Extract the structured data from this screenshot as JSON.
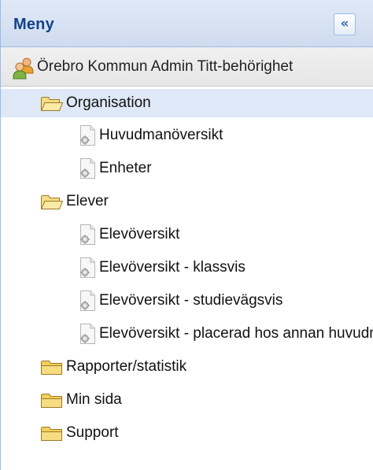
{
  "header": {
    "title": "Meny",
    "collapse_icon": "double-chevron-left-icon"
  },
  "user": {
    "icon": "users-icon",
    "name": "Örebro Kommun Admin Titt-behörighet"
  },
  "tree": {
    "organisation": {
      "label": "Organisation",
      "icon": "folder-open-icon",
      "selected": true,
      "children": [
        {
          "label": "Huvudmanöversikt",
          "icon": "page-gear-icon"
        },
        {
          "label": "Enheter",
          "icon": "page-gear-icon"
        }
      ]
    },
    "elever": {
      "label": "Elever",
      "icon": "folder-open-icon",
      "children": [
        {
          "label": "Elevöversikt",
          "icon": "page-gear-icon"
        },
        {
          "label": "Elevöversikt - klassvis",
          "icon": "page-gear-icon"
        },
        {
          "label": "Elevöversikt - studievägsvis",
          "icon": "page-gear-icon"
        },
        {
          "label": "Elevöversikt - placerad hos annan huvudman",
          "icon": "page-gear-icon"
        }
      ]
    },
    "rapporter": {
      "label": "Rapporter/statistik",
      "icon": "folder-icon"
    },
    "min_sida": {
      "label": "Min sida",
      "icon": "folder-icon"
    },
    "support": {
      "label": "Support",
      "icon": "folder-icon"
    }
  },
  "colors": {
    "header_title": "#15428b",
    "selected_row": "#dfe8f6",
    "border": "#99bbe8",
    "folder": "#f5d56e"
  }
}
